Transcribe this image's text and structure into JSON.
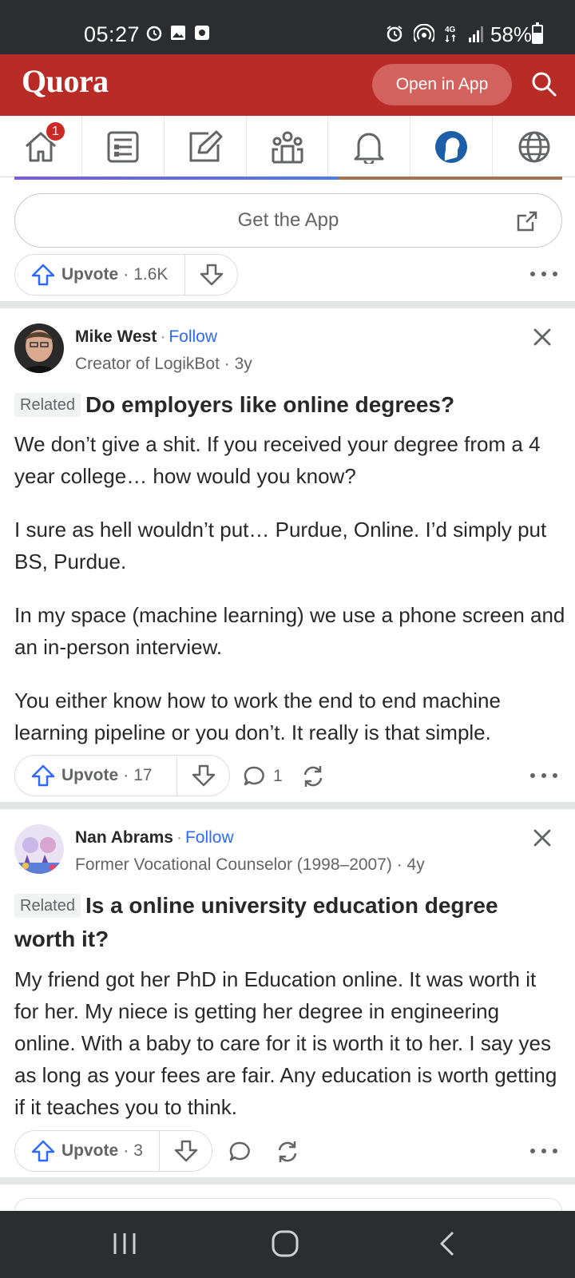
{
  "status_bar": {
    "time": "05:27",
    "battery": "58%",
    "battery_level": 0.58,
    "left_icons": [
      "alarm-clock-icon",
      "gallery-icon",
      "screenshot-icon"
    ],
    "right_icons": [
      "alarm-icon",
      "hotspot-icon",
      "4g-data-icon",
      "signal-icon"
    ],
    "network": "4G"
  },
  "header": {
    "logo": "Quora",
    "open_in_app": "Open in App",
    "brand_color": "#b92b27"
  },
  "nav": {
    "home_badge": "1",
    "tabs": [
      "home-icon",
      "following-icon",
      "write-icon",
      "spaces-icon",
      "notifications-icon",
      "profile-icon",
      "languages-icon"
    ]
  },
  "reading_progress": 0.59,
  "get_app": {
    "label": "Get the App"
  },
  "top_actions": {
    "upvote_label": "Upvote",
    "upvote_count": "1.6K"
  },
  "answers": [
    {
      "author": "Mike West",
      "follow": "Follow",
      "credential": "Creator of LogikBot · 3y",
      "related": "Related",
      "question": "Do employers like online degrees?",
      "paragraphs": [
        "We don’t give a shit. If you received your degree from a 4 year college… how would you know?",
        "I sure as hell wouldn’t put… Purdue, Online. I’d simply put BS, Purdue.",
        "In my space (machine learning) we use a phone screen and an in-person interview.",
        "You either know how to work the end to end machine learning pipeline or you don’t. It really is that simple."
      ],
      "upvote_label": "Upvote",
      "upvote_count": "17",
      "comment_count": "1"
    },
    {
      "author": "Nan Abrams",
      "follow": "Follow",
      "credential": "Former Vocational Counselor (1998–2007) · 4y",
      "related": "Related",
      "question": "Is a online university education degree worth it?",
      "paragraphs": [
        "My friend got her PhD in Education online. It was worth it for her. My niece is getting her degree in engineering online. With a baby to care for it is worth it to her. I say yes as long as your fees are fair. Any education is worth getting if it teaches you to think."
      ],
      "upvote_label": "Upvote",
      "upvote_count": "3"
    }
  ],
  "system_nav": [
    "recent-apps-icon",
    "home-circle-icon",
    "back-icon"
  ]
}
